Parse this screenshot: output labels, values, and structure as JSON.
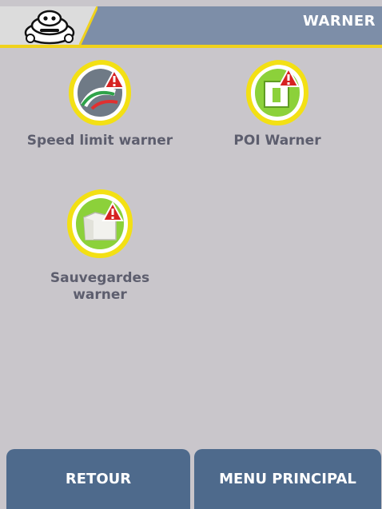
{
  "header": {
    "title": "WARNER"
  },
  "items": [
    {
      "label": "Speed limit warner",
      "icon": "speed-limit-warning-icon"
    },
    {
      "label": "POI Warner",
      "icon": "poi-warning-icon"
    },
    {
      "label_line1": "Sauvegardes",
      "label_line2": "warner",
      "icon": "saved-warning-icon"
    }
  ],
  "footer": {
    "back_label": "RETOUR",
    "main_menu_label": "MENU PRINCIPAL"
  },
  "colors": {
    "header_bar": "#7d8ea8",
    "accent": "#f0d21c",
    "button": "#4e6a8c",
    "background": "#c9c6cb"
  }
}
